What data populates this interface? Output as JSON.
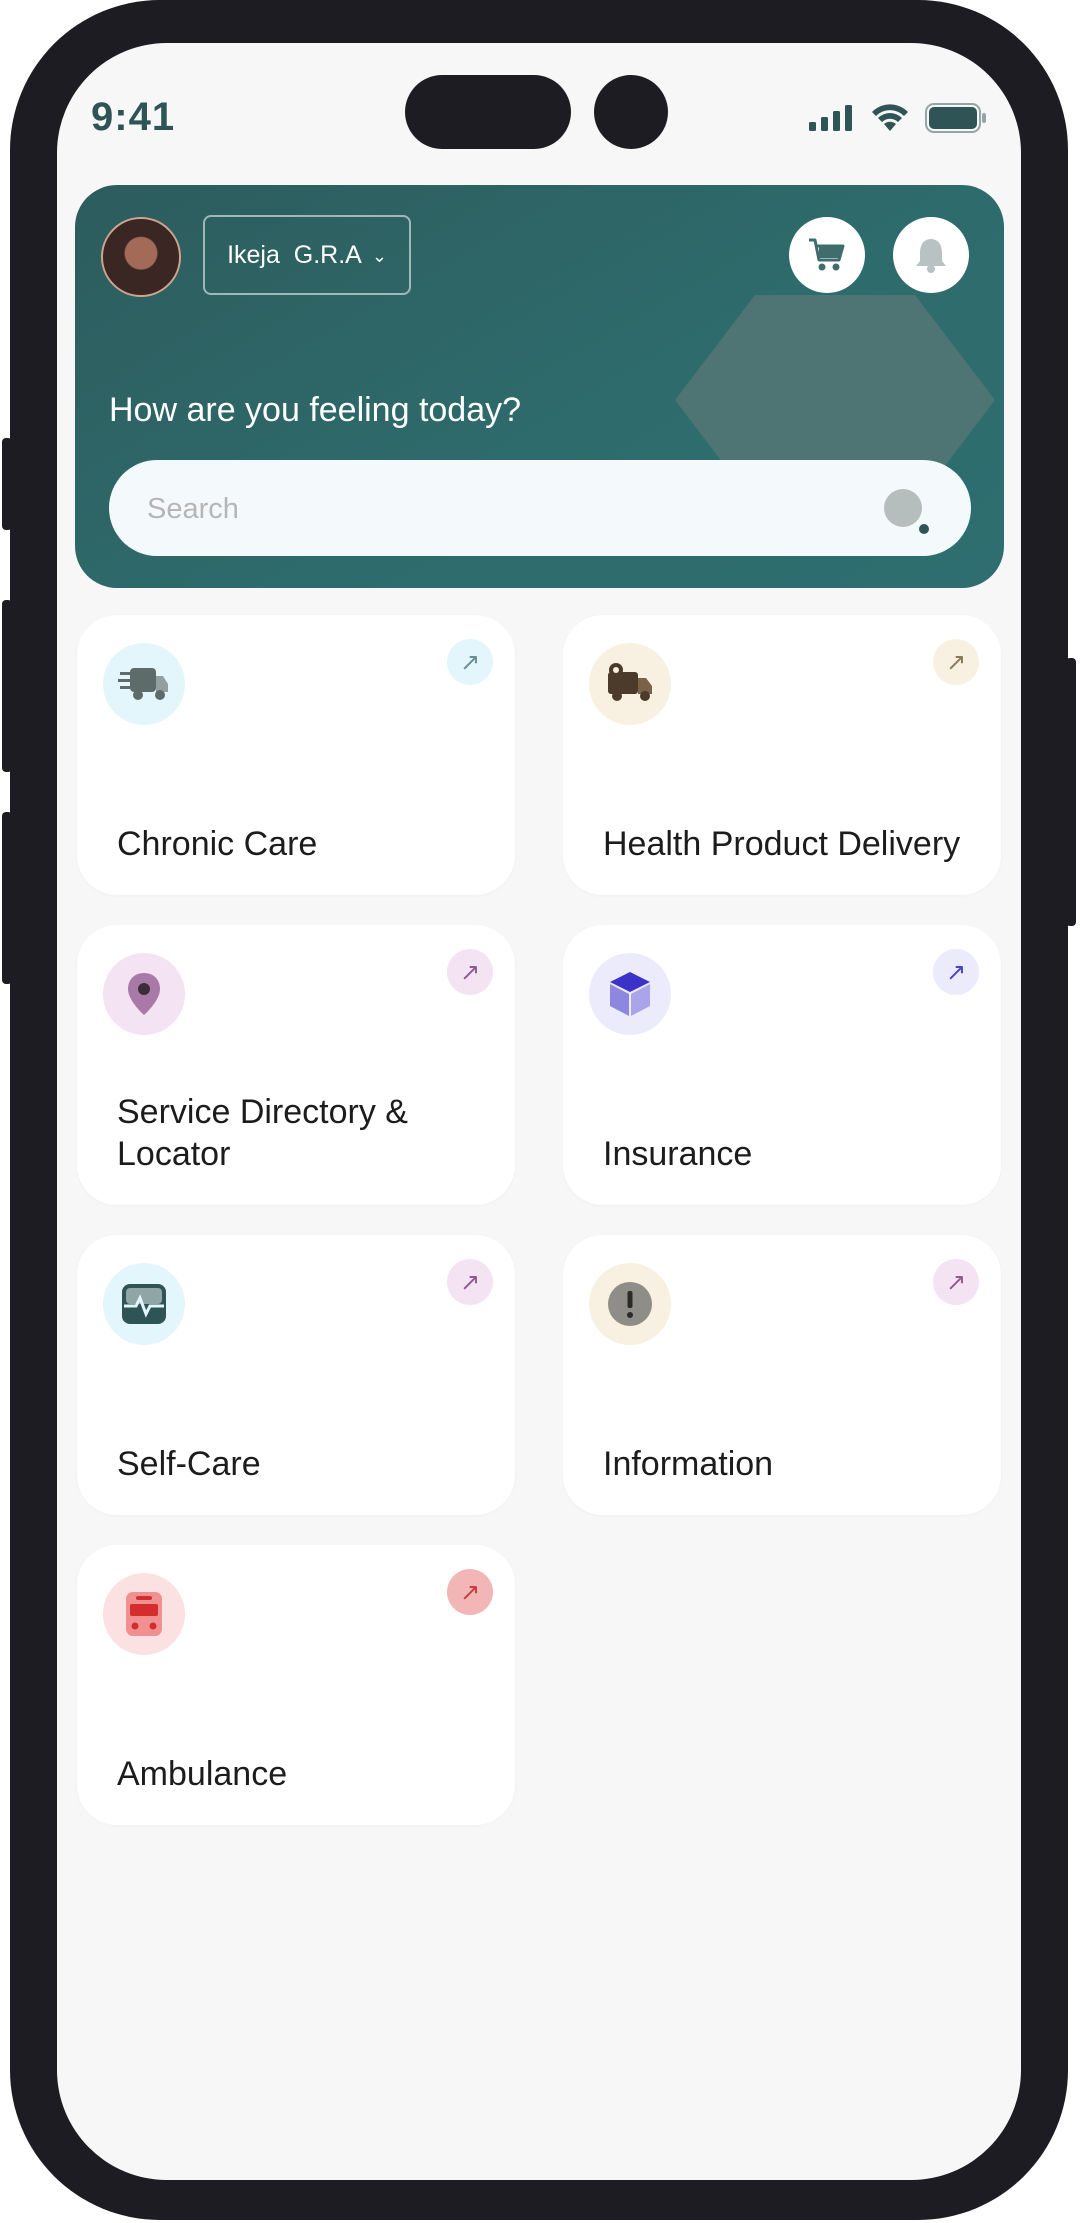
{
  "status_bar": {
    "time": "9:41"
  },
  "header": {
    "location": "Ikeja  G.R.A",
    "greeting": "How are you feeling today?",
    "search": {
      "placeholder": "Search",
      "value": ""
    }
  },
  "tiles": [
    {
      "label": "Chronic Care",
      "icon": "truck-icon",
      "color": "#e3f6fb"
    },
    {
      "label": "Health Product Delivery",
      "icon": "delivery-truck-icon",
      "color": "#f8f1e1"
    },
    {
      "label": "Service Directory & Locator",
      "icon": "location-pin-icon",
      "color": "#f3e3f3"
    },
    {
      "label": "Insurance",
      "icon": "box-icon",
      "color": "#ecebfb"
    },
    {
      "label": "Self-Care",
      "icon": "health-monitor-icon",
      "color": "#e3f6fb"
    },
    {
      "label": "Information",
      "icon": "info-icon",
      "color": "#f8f1e1"
    },
    {
      "label": "Ambulance",
      "icon": "ambulance-icon",
      "color": "#fbe1e1"
    }
  ],
  "colors": {
    "header": "#2e6566",
    "accent": "#2f5455"
  }
}
